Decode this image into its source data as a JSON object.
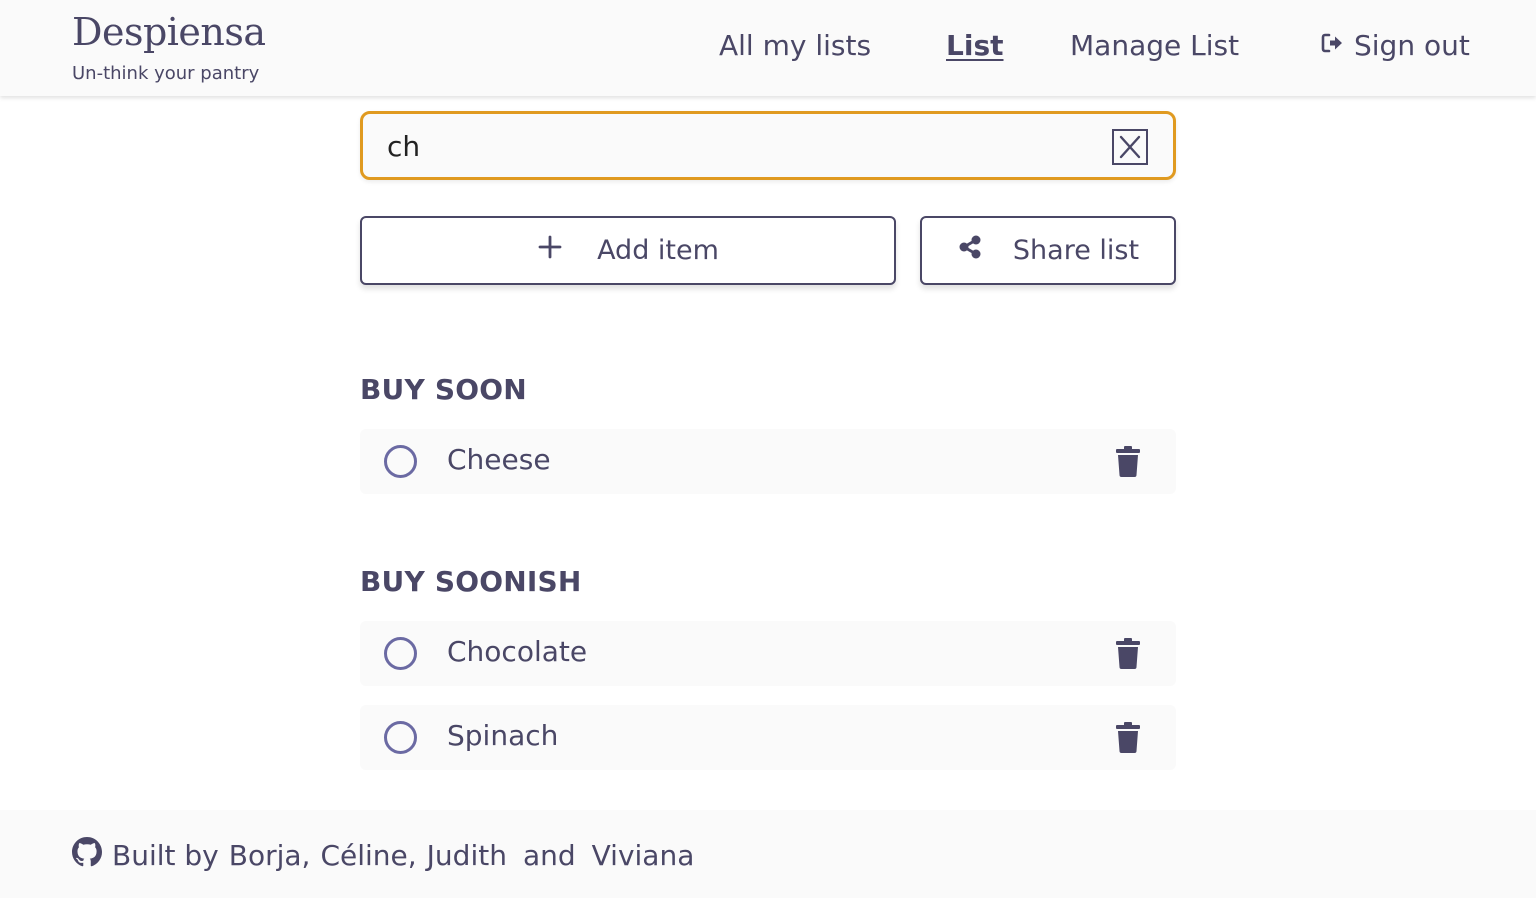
{
  "brand": {
    "name": "Despiensa",
    "tagline": "Un-think your pantry"
  },
  "nav": {
    "all_lists": "All my lists",
    "list": "List",
    "manage_list": "Manage List",
    "sign_out": "Sign out"
  },
  "search": {
    "value": "ch",
    "clear_icon": "close-x-icon",
    "focus_color": "#e09a20"
  },
  "actions": {
    "add_item": "Add item",
    "share_list": "Share list",
    "add_icon": "plus-icon",
    "share_icon": "share-icon"
  },
  "sections": [
    {
      "title": "BUY SOON",
      "items": [
        {
          "name": "Cheese"
        }
      ]
    },
    {
      "title": "BUY SOONISH",
      "items": [
        {
          "name": "Chocolate"
        },
        {
          "name": "Spinach"
        }
      ]
    }
  ],
  "footer": {
    "built_by": "Built by",
    "author_1": "Borja,",
    "author_2": "Céline,",
    "author_3": "Judith",
    "and": "and",
    "author_4": "Viviana",
    "icon": "github-icon"
  },
  "colors": {
    "text": "#4a4766",
    "accent": "#e09a20",
    "checkbox": "#6b6aa3",
    "surface": "#fafafa"
  }
}
